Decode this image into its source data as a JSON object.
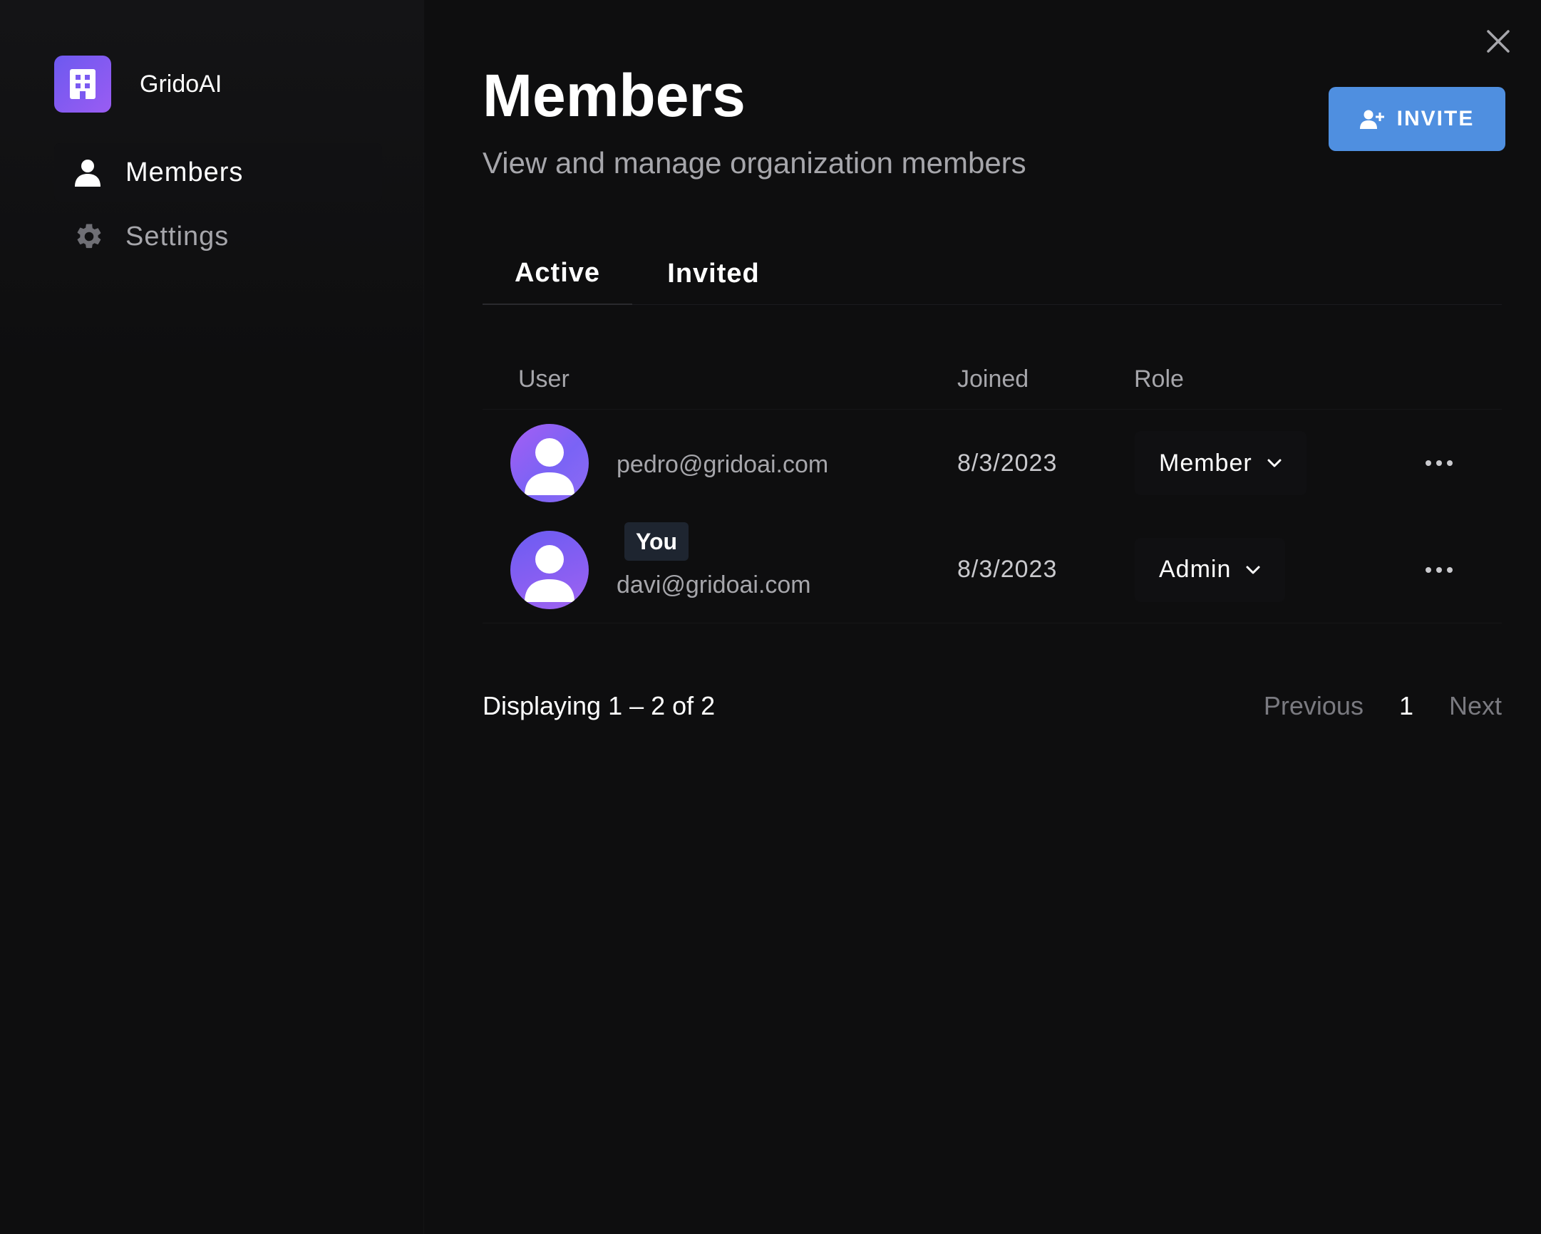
{
  "org": {
    "name": "GridoAI",
    "logo_icon": "building-icon",
    "logo_color": "#7b5af1"
  },
  "sidebar": {
    "items": [
      {
        "label": "Members",
        "icon": "person-icon",
        "active": true
      },
      {
        "label": "Settings",
        "icon": "gear-icon",
        "active": false
      }
    ]
  },
  "header": {
    "title": "Members",
    "subtitle": "View and manage organization members",
    "invite_label": "INVITE",
    "invite_icon": "add-user-icon",
    "accent": "#4f8fe0"
  },
  "tabs": [
    {
      "label": "Active",
      "selected": true
    },
    {
      "label": "Invited",
      "selected": false
    }
  ],
  "table": {
    "headers": {
      "user": "User",
      "joined": "Joined",
      "role": "Role"
    },
    "rows": [
      {
        "email": "pedro@gridoai.com",
        "joined": "8/3/2023",
        "role": "Member",
        "badge": ""
      },
      {
        "email": "davi@gridoai.com",
        "joined": "8/3/2023",
        "role": "Admin",
        "badge": "You"
      }
    ]
  },
  "footer": {
    "displaying": "Displaying 1 – 2 of 2",
    "previous": "Previous",
    "page": "1",
    "next": "Next"
  }
}
